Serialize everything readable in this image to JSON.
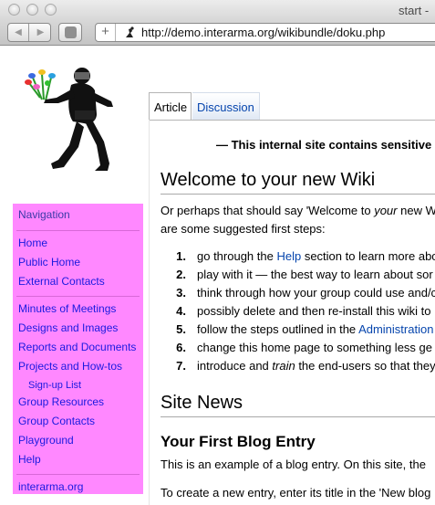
{
  "browser": {
    "window_title": "start -",
    "url": "http://demo.interarma.org/wikibundle/doku.php",
    "back_glyph": "◀",
    "forward_glyph": "▶",
    "new_tab_glyph": "+",
    "icons": [
      "window-close-icon",
      "window-minimize-icon",
      "window-zoom-icon",
      "back-arrow-icon",
      "forward-arrow-icon",
      "stop-icon",
      "add-icon",
      "favicon-icon"
    ]
  },
  "sidebar": {
    "heading": "Navigation",
    "background": "#ff88ff",
    "link_color": "#1a1ae0",
    "group1": [
      "Home",
      "Public Home",
      "External Contacts"
    ],
    "group2": [
      "Minutes of Meetings",
      "Designs and Images",
      "Reports and Documents",
      "Projects and How-tos"
    ],
    "sub": "Sign-up List",
    "group3": [
      "Group Resources",
      "Group Contacts",
      "Playground",
      "Help"
    ],
    "footer": "interarma.org"
  },
  "tabs": {
    "article": "Article",
    "discussion": "Discussion"
  },
  "content": {
    "notice": "— This internal site contains sensitive",
    "title": "Welcome to your new Wiki",
    "intro_line1_a": "Or perhaps that should say 'Welcome to ",
    "intro_line1_em": "your",
    "intro_line1_b": " new W",
    "intro_line2": "are some suggested first steps:",
    "steps": [
      {
        "num": "1.",
        "before": "go through the ",
        "link": "Help",
        "after": " section to learn more abo"
      },
      {
        "num": "2.",
        "before": "play with it — the best way to learn about sor",
        "link": "",
        "after": ""
      },
      {
        "num": "3.",
        "before": "think through how your group could use and/c",
        "link": "",
        "after": ""
      },
      {
        "num": "4.",
        "before": "possibly delete and then re-install this wiki to",
        "link": "",
        "after": ""
      },
      {
        "num": "5.",
        "before": "follow the steps outlined in the ",
        "link": "Administration",
        "after": ""
      },
      {
        "num": "6.",
        "before": "change this home page to something less ge",
        "link": "",
        "after": ""
      },
      {
        "num": "7.",
        "before": "introduce and ",
        "em": "train",
        "after": " the end-users so that they"
      }
    ],
    "news_title": "Site News",
    "blog_title": "Your First Blog Entry",
    "blog_p1": "This is an example of a blog entry. On this site, the",
    "blog_p2": "To create a new entry, enter its title in the 'New blog"
  }
}
